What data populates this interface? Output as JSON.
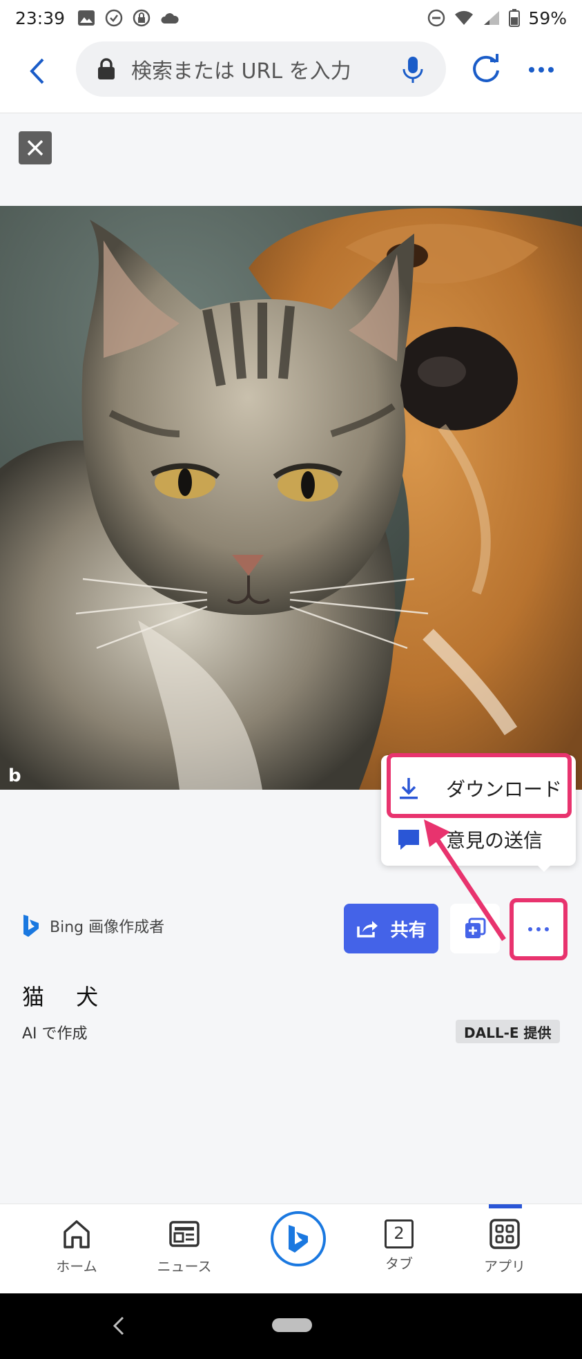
{
  "status_bar": {
    "time": "23:39",
    "battery": "59%"
  },
  "browser": {
    "search_placeholder": "検索または URL を入力"
  },
  "menu": {
    "download_label": "ダウンロード",
    "feedback_label": "意見の送信"
  },
  "creator": {
    "label": "Bing 画像作成者"
  },
  "actions": {
    "share_label": "共有"
  },
  "image_info": {
    "title": "猫 犬",
    "subtitle": "AI で作成",
    "badge": "DALL-E 提供"
  },
  "bottom_nav": {
    "home": "ホーム",
    "news": "ニュース",
    "tab_count": "2",
    "tab": "タブ",
    "apps": "アプリ"
  },
  "colors": {
    "accent": "#4463e8",
    "highlight": "#e8336e",
    "browser_blue": "#1a5cc8"
  }
}
